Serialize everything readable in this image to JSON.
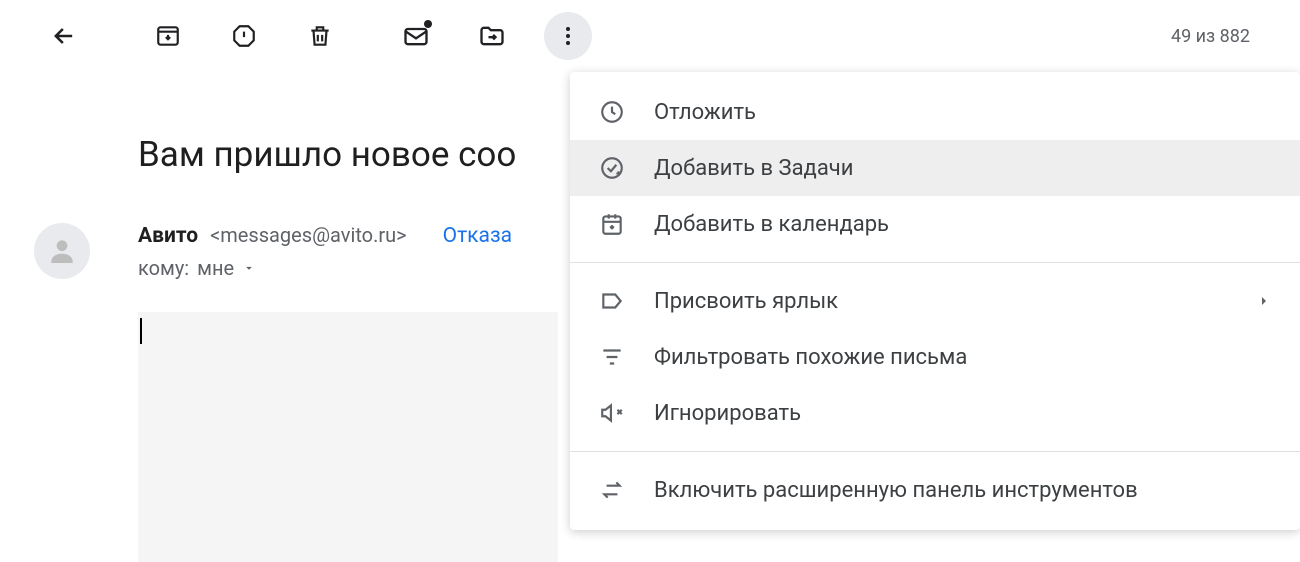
{
  "counter": "49 из 882",
  "subject": "Вам пришло новое соо",
  "sender": {
    "name": "Авито",
    "email": "<messages@avito.ru>",
    "unsubscribe": "Отказа"
  },
  "recipient": {
    "prefix": "кому:",
    "to": "мне"
  },
  "dropdown": {
    "snooze": "Отложить",
    "add_tasks": "Добавить в Задачи",
    "add_calendar": "Добавить в календарь",
    "label": "Присвоить ярлык",
    "filter": "Фильтровать похожие письма",
    "mute": "Игнорировать",
    "expand_toolbar": "Включить расширенную панель инструментов"
  }
}
